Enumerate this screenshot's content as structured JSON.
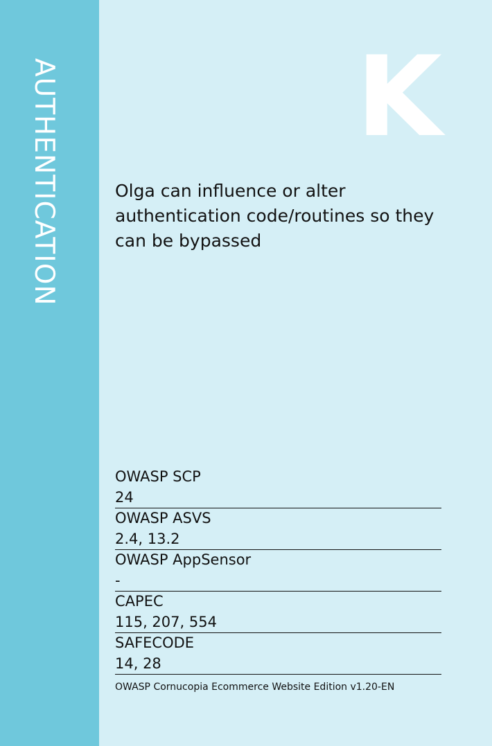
{
  "card": {
    "suit": "AUTHENTICATION",
    "letter": "K",
    "description": "Olga can influence or alter authentication code/routines so they can be bypassed"
  },
  "references": [
    {
      "label": "OWASP SCP",
      "value": "24"
    },
    {
      "label": "OWASP ASVS",
      "value": "2.4, 13.2"
    },
    {
      "label": "OWASP AppSensor",
      "value": "-"
    },
    {
      "label": "CAPEC",
      "value": "115, 207, 554"
    },
    {
      "label": "SAFECODE",
      "value": "14, 28"
    }
  ],
  "footer": "OWASP Cornucopia Ecommerce Website Edition v1.20-EN",
  "colors": {
    "sidebar": "#6fc8dc",
    "background": "#d5eff6",
    "letter": "#ffffff"
  }
}
